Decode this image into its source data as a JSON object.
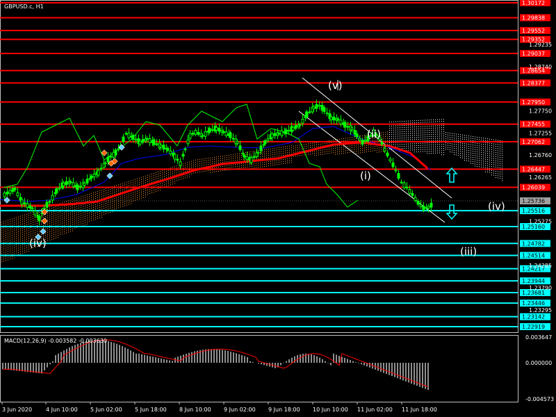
{
  "chart_title": "GBPUSD.c, H1",
  "macd_label": "MACD(12,26,9) -0.003582 -0.003630",
  "macd_axis": [
    "0.003647",
    "0.000000",
    "-0.004573"
  ],
  "colors": {
    "background": "#000000",
    "resistance_line": "#ff0000",
    "support_line": "#00ffff",
    "candles": "#00ff00",
    "tenkan": "#0000ff",
    "kijun": "#ff0000",
    "cloud_a": "#ff9933",
    "cloud_b": "#ffffff",
    "chikou": "#00ff00",
    "grid_text": "#ffffff",
    "axis_dark": "#c0c0c0",
    "current_price": "#a0a0a0",
    "macd_hist": "#c0c0c0",
    "macd_signal": "#ff0000"
  },
  "resistance_levels": [
    "1.30172",
    "1.29838",
    "1.29552",
    "1.29352",
    "1.29037",
    "1.28654",
    "1.28377",
    "1.27950",
    "1.27455",
    "1.27062",
    "1.26447",
    "1.26039"
  ],
  "support_levels": [
    "1.25516",
    "1.25160",
    "1.24782",
    "1.24514",
    "1.24217",
    "1.23944",
    "1.23681",
    "1.23446",
    "1.23142",
    "1.22919"
  ],
  "current_price": "1.25736",
  "price_ticks": [
    "1.29235",
    "1.28740",
    "1.27750",
    "1.27255",
    "1.26760",
    "1.26265",
    "1.25275",
    "1.24285",
    "1.23790",
    "1.23295"
  ],
  "time_labels": [
    "3 Jun 2020",
    "4 Jun 10:00",
    "5 Jun 02:00",
    "5 Jun 18:00",
    "8 Jun 10:00",
    "9 Jun 02:00",
    "9 Jun 18:00",
    "10 Jun 10:00",
    "11 Jun 02:00",
    "11 Jun 18:00"
  ],
  "wave_labels": [
    "(v)",
    "(ii)",
    "(i)",
    "(iv)",
    "(iii)",
    "(iv)"
  ],
  "icons": [
    "arrow-up-icon",
    "arrow-down-icon"
  ]
}
